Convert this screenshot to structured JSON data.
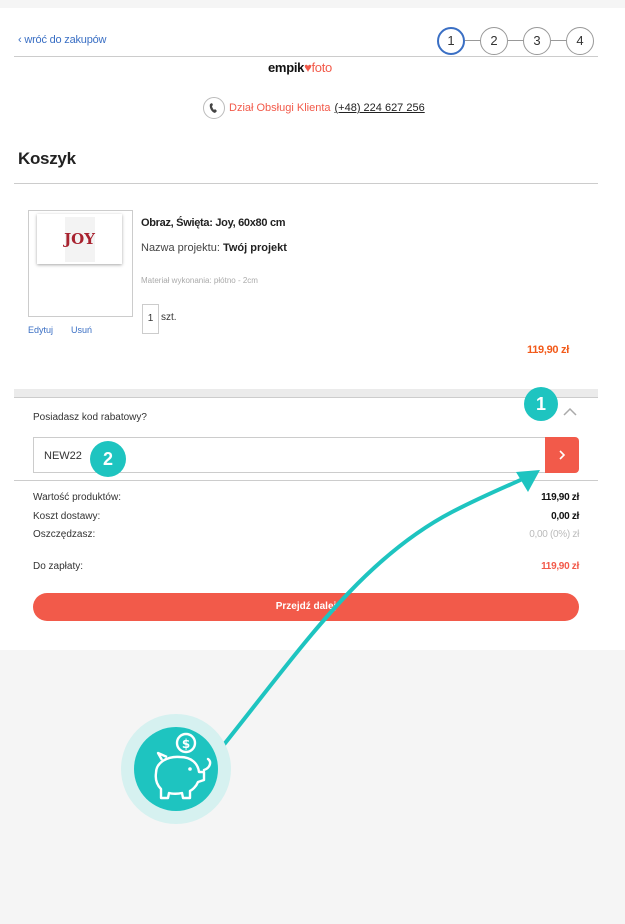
{
  "header": {
    "back_link": "‹ wróć do zakupów",
    "steps": [
      "1",
      "2",
      "3",
      "4"
    ],
    "active_step": 1,
    "logo": {
      "brand": "empik",
      "suffix": "foto"
    },
    "support": {
      "label": "Dział Obsługi Klienta",
      "phone": "(+48) 224 627 256"
    }
  },
  "cart": {
    "title": "Koszyk",
    "item": {
      "name": "Obraz, Święta: Joy, 60x80 cm",
      "project_label": "Nazwa projektu:",
      "project_value": "Twój projekt",
      "material": "Materiał wykonania: płótno - 2cm",
      "quantity": "1",
      "unit": "szt.",
      "price": "119,90 zł",
      "thumb_text": "JOY",
      "edit_label": "Edytuj",
      "remove_label": "Usuń"
    }
  },
  "promo": {
    "question": "Posiadasz kod rabatowy?",
    "code_value": "NEW22"
  },
  "summary": {
    "rows": [
      {
        "label": "Wartość produktów:",
        "value": "119,90 zł"
      },
      {
        "label": "Koszt dostawy:",
        "value": "0,00 zł"
      },
      {
        "label": "Oszczędzasz:",
        "value": "0,00 (0%) zł"
      }
    ],
    "total_label": "Do zapłaty:",
    "total_value": "119,90 zł",
    "cta_label": "Przejdź dalej"
  },
  "annotations": {
    "badge_1": "1",
    "badge_2": "2",
    "accent_color": "#1ec4c0",
    "brand_color": "#f25a4a",
    "illustration_icon": "piggy-bank-icon"
  }
}
